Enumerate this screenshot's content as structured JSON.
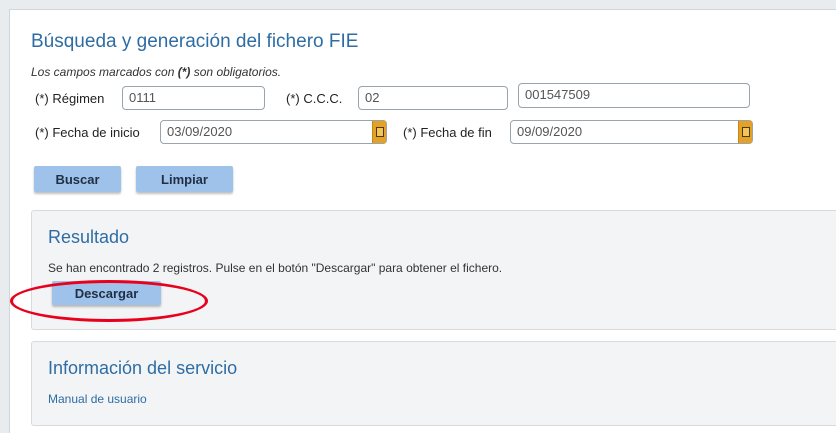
{
  "form": {
    "title": "Búsqueda y generación del fichero FIE",
    "required_note_prefix": "Los campos marcados con ",
    "required_note_marker": "(*)",
    "required_note_suffix": " son obligatorios.",
    "regimen_label": "(*) Régimen",
    "regimen_value": "0111",
    "ccc_label": "(*) C.C.C.",
    "ccc_prefix_value": "02",
    "ccc_number_value": "001547509",
    "fecha_inicio_label": "(*) Fecha de inicio",
    "fecha_inicio_value": "03/09/2020",
    "fecha_fin_label": "(*) Fecha de fin",
    "fecha_fin_value": "09/09/2020",
    "buscar_label": "Buscar",
    "limpiar_label": "Limpiar"
  },
  "resultado": {
    "title": "Resultado",
    "message": "Se han encontrado 2 registros. Pulse en el botón \"Descargar\" para obtener el fichero.",
    "descargar_label": "Descargar"
  },
  "informacion": {
    "title": "Información del servicio",
    "manual_link": "Manual de usuario"
  },
  "icons": {
    "calendar": "calendar-icon"
  },
  "colors": {
    "accent_blue": "#2e6da4",
    "button_blue": "#9fc2ea",
    "calendar_orange": "#e3a227",
    "annotation_red": "#e8001c"
  }
}
